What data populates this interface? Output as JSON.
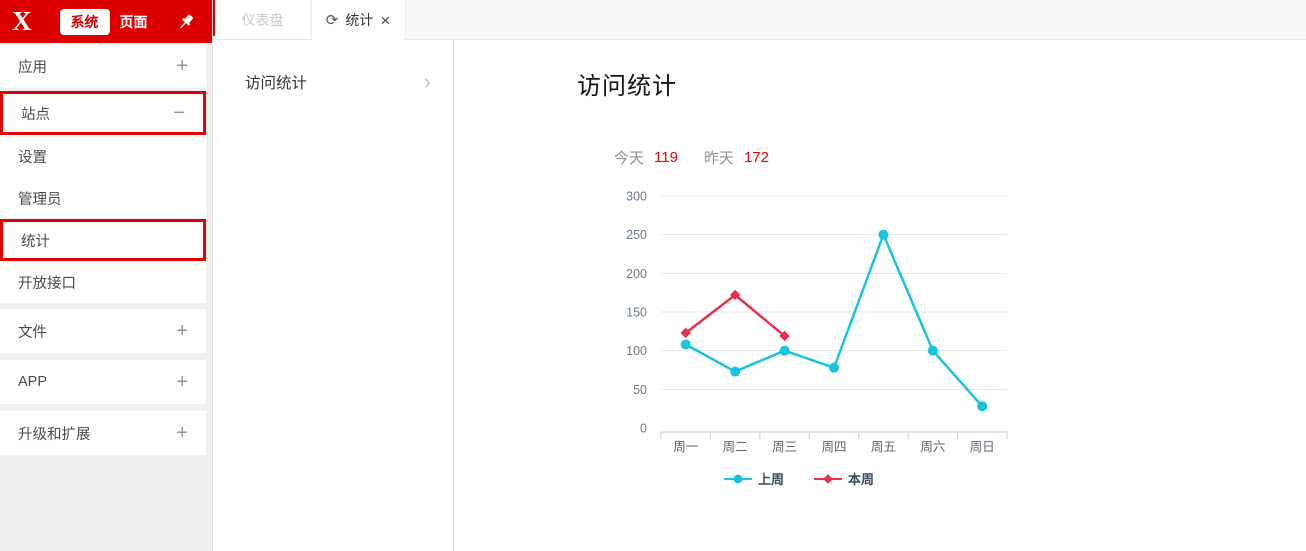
{
  "colors": {
    "brand_red": "#dd0000",
    "highlight_border": "#e30000",
    "stat_number": "#e60000",
    "last_week_line": "#17c4de",
    "this_week_line": "#e8304c"
  },
  "header": {
    "logo": "X",
    "nav_system": "系统",
    "nav_page": "页面"
  },
  "tabs": {
    "dashboard": "仪表盘",
    "stats": "统计",
    "refresh_icon": "⟳",
    "close_icon": "×"
  },
  "sidebar": {
    "items": [
      {
        "label": "应用",
        "toggle": "+"
      },
      {
        "label": "站点",
        "toggle": "−",
        "highlighted": true
      },
      {
        "label": "设置"
      },
      {
        "label": "管理员"
      },
      {
        "label": "统计",
        "highlighted": true
      },
      {
        "label": "开放接口"
      },
      {
        "label": "文件",
        "toggle": "+"
      },
      {
        "label": "APP",
        "toggle": "+"
      },
      {
        "label": "升级和扩展",
        "toggle": "+"
      }
    ]
  },
  "panel": {
    "title": "访问统计",
    "chevron": "›"
  },
  "main": {
    "title": "访问统计",
    "stats": [
      {
        "label": "今天",
        "value": "119"
      },
      {
        "label": "昨天",
        "value": "172"
      }
    ]
  },
  "chart_data": {
    "type": "line",
    "title": "访问统计",
    "categories": [
      "周一",
      "周二",
      "周三",
      "周四",
      "周五",
      "周六",
      "周日"
    ],
    "series": [
      {
        "name": "上周",
        "color": "#17c4de",
        "marker": "circle",
        "values": [
          108,
          73,
          100,
          78,
          250,
          100,
          28
        ]
      },
      {
        "name": "本周",
        "color": "#e8304c",
        "marker": "diamond",
        "values": [
          123,
          172,
          119
        ]
      }
    ],
    "ylim": [
      0,
      300
    ],
    "ytick_step": 50,
    "grid": true,
    "legend_position": "bottom"
  }
}
